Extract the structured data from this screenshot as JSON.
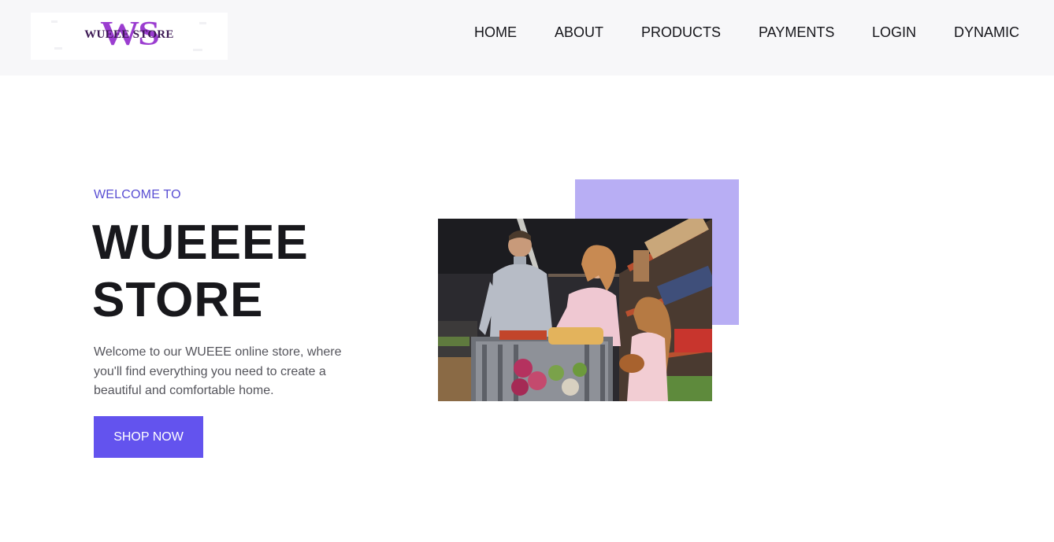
{
  "header": {
    "logo": {
      "monogram": "WS",
      "text": "WUEEE STORE",
      "color": "#9b3dd0"
    },
    "nav": [
      {
        "label": "HOME"
      },
      {
        "label": "ABOUT"
      },
      {
        "label": "PRODUCTS"
      },
      {
        "label": "PAYMENTS"
      },
      {
        "label": "LOGIN"
      },
      {
        "label": "DYNAMIC"
      }
    ]
  },
  "hero": {
    "eyebrow": "WELCOME TO",
    "title": "WUEEEE STORE",
    "description": "Welcome to our WUEEE online store, where you'll find everything you need to create a beautiful and comfortable home.",
    "cta_label": "SHOP NOW",
    "photo_alt": "Family shopping with a cart in a grocery store"
  },
  "colors": {
    "accent": "#6353ee",
    "accent_light": "#b8aef4",
    "eyebrow": "#5a4fd3",
    "header_bg": "#f7f7f9"
  }
}
